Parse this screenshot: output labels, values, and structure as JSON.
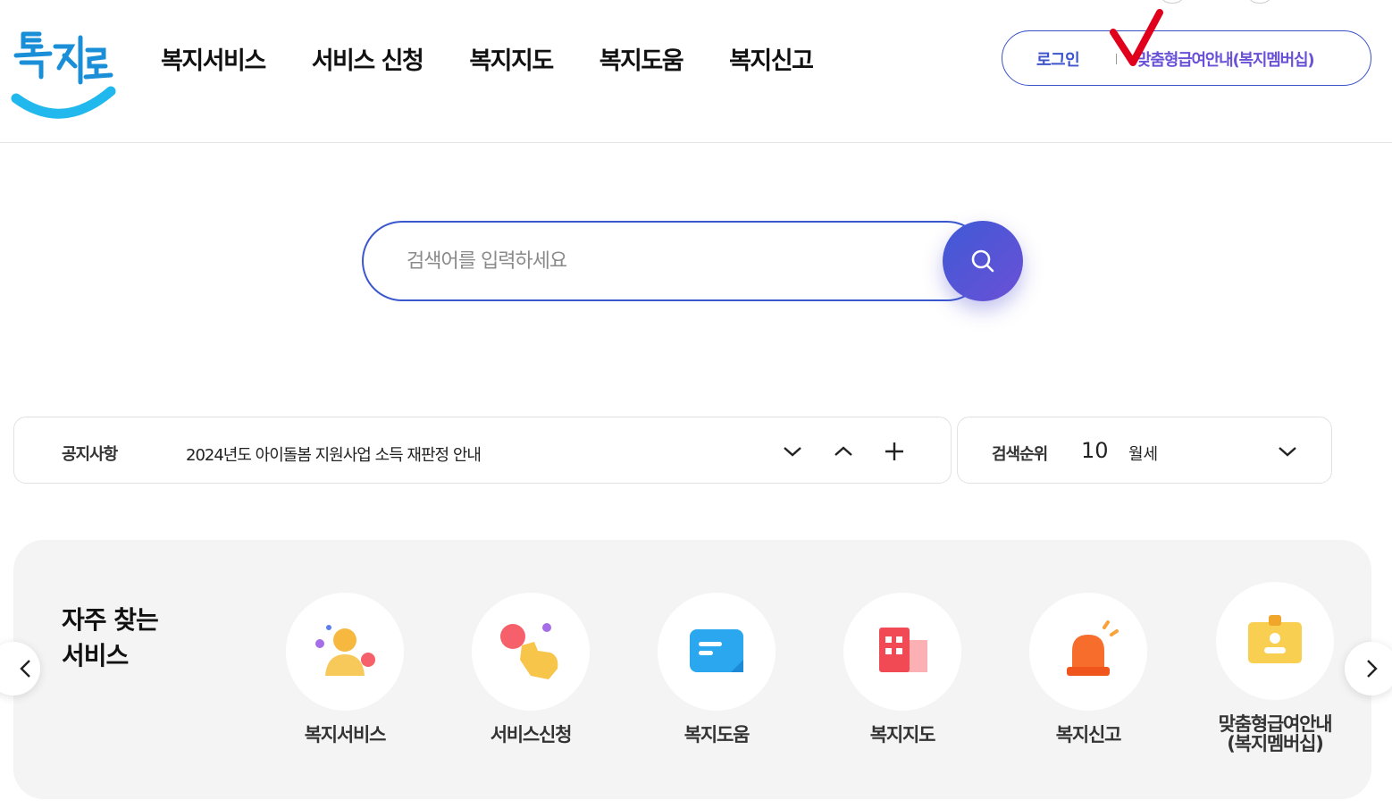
{
  "logo": {
    "text": "복지로"
  },
  "gnb": [
    "복지서비스",
    "서비스 신청",
    "복지지도",
    "복지도움",
    "복지신고"
  ],
  "user_menu": {
    "login": "로그인",
    "membership": "맞춤형급여안내(복지멤버십)"
  },
  "search": {
    "placeholder": "검색어를 입력하세요"
  },
  "notice": {
    "title": "공지사항",
    "text": "2024년도 아이돌봄 지원사업 소득 재판정 안내"
  },
  "ranking": {
    "title": "검색순위",
    "number": "10",
    "keyword": "월세"
  },
  "frequent": {
    "title_line1": "자주 찾는",
    "title_line2": "서비스",
    "items": [
      {
        "label": "복지서비스",
        "icon": "people-icon"
      },
      {
        "label": "서비스신청",
        "icon": "touch-hand-icon"
      },
      {
        "label": "복지도움",
        "icon": "chat-bubble-icon"
      },
      {
        "label": "복지지도",
        "icon": "building-icon"
      },
      {
        "label": "복지신고",
        "icon": "siren-icon"
      },
      {
        "label_line1": "맞춤형급여안내",
        "label_line2": "(복지멤버십)",
        "icon": "id-card-icon"
      }
    ]
  },
  "colors": {
    "primary": "#3d55cc",
    "accent": "#6a52d8",
    "check": "#e0001b",
    "panel": "#f4f4f4"
  }
}
